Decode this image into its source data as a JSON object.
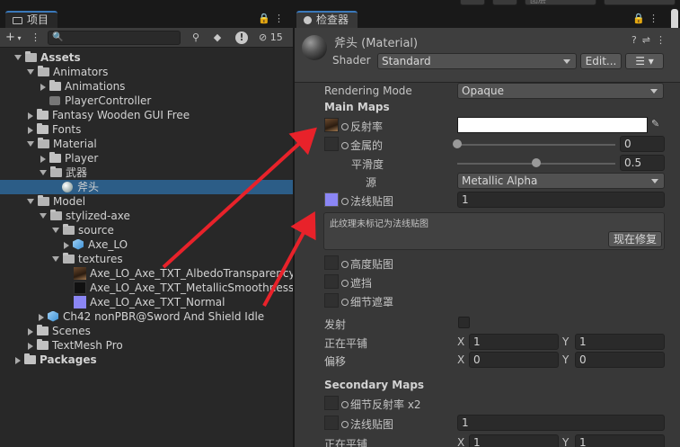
{
  "topbar": {
    "partial_text": "图层"
  },
  "project": {
    "tab_label": "项目",
    "toolbar": {
      "add_label": "+",
      "search_placeholder": "",
      "hidden_count": "15"
    },
    "tree": [
      {
        "label": "Assets",
        "bold": true
      },
      {
        "label": "Animators"
      },
      {
        "label": "Animations"
      },
      {
        "label": "PlayerController"
      },
      {
        "label": "Fantasy Wooden GUI  Free"
      },
      {
        "label": "Fonts"
      },
      {
        "label": "Material"
      },
      {
        "label": "Player"
      },
      {
        "label": "武器"
      },
      {
        "label": "斧头"
      },
      {
        "label": "Model"
      },
      {
        "label": "stylized-axe"
      },
      {
        "label": "source"
      },
      {
        "label": "Axe_LO"
      },
      {
        "label": "textures"
      },
      {
        "label": "Axe_LO_Axe_TXT_AlbedoTransparency"
      },
      {
        "label": "Axe_LO_Axe_TXT_MetallicSmoothness"
      },
      {
        "label": "Axe_LO_Axe_TXT_Normal"
      },
      {
        "label": "Ch42 nonPBR@Sword And Shield Idle"
      },
      {
        "label": "Scenes"
      },
      {
        "label": "TextMesh Pro"
      },
      {
        "label": "Packages",
        "bold": true
      }
    ]
  },
  "inspector": {
    "tab_label": "检查器",
    "material_title": "斧头 (Material)",
    "shader_label": "Shader",
    "shader_value": "Standard",
    "edit_button": "Edit...",
    "rendering_mode_label": "Rendering Mode",
    "rendering_mode_value": "Opaque",
    "main_maps_label": "Main Maps",
    "albedo_label": "反射率",
    "metallic_label": "金属的",
    "metallic_value": "0",
    "metallic_fraction": 0,
    "smoothness_label": "平滑度",
    "smoothness_value": "0.5",
    "smoothness_fraction": 0.5,
    "source_label": "源",
    "source_value": "Metallic Alpha",
    "normal_label": "法线贴图",
    "normal_value": "1",
    "help_message": "此纹理未标记为法线贴图",
    "fix_now_button": "现在修复",
    "height_label": "高度贴图",
    "occlusion_label": "遮挡",
    "detail_mask_label": "细节遮罩",
    "emission_label": "发射",
    "tiling_label": "正在平铺",
    "tiling_x": "1",
    "tiling_y": "1",
    "offset_label": "偏移",
    "offset_x": "0",
    "offset_y": "0",
    "x_label": "X",
    "y_label": "Y",
    "secondary_maps_label": "Secondary Maps",
    "detail_albedo_label": "细节反射率 x2",
    "secondary_normal_label": "法线贴图",
    "secondary_normal_value": "1",
    "secondary_tiling_label": "正在平铺",
    "secondary_tiling_x": "1",
    "secondary_tiling_y": "1"
  },
  "colors": {
    "selection": "#2c5d87",
    "annotation_arrow": "#e8222a",
    "normal_map": "#8b86f5"
  }
}
